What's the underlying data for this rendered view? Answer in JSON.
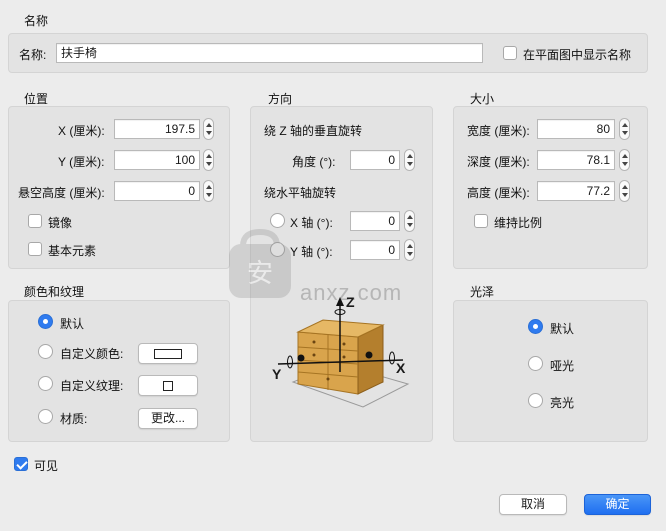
{
  "name_section": {
    "title": "名称",
    "name_label": "名称:",
    "name_value": "扶手椅",
    "show_in_plan_label": "在平面图中显示名称",
    "show_in_plan_checked": false
  },
  "position_section": {
    "title": "位置",
    "x_label": "X (厘米):",
    "x_value": "197.5",
    "y_label": "Y (厘米):",
    "y_value": "100",
    "elevation_label": "悬空高度 (厘米):",
    "elevation_value": "0",
    "mirror_label": "镜像",
    "mirror_checked": false,
    "basic_element_label": "基本元素",
    "basic_element_checked": false
  },
  "orientation_section": {
    "title": "方向",
    "z_rotate_label": "绕 Z 轴的垂直旋转",
    "angle_label": "角度 (°):",
    "angle_value": "0",
    "horizontal_rotate_label": "绕水平轴旋转",
    "x_axis_label": "X 轴 (°):",
    "x_axis_value": "0",
    "y_axis_label": "Y 轴 (°):",
    "y_axis_value": "0",
    "axis_labels": {
      "z": "Z",
      "x": "X",
      "y": "Y"
    }
  },
  "size_section": {
    "title": "大小",
    "width_label": "宽度 (厘米):",
    "width_value": "80",
    "depth_label": "深度 (厘米):",
    "depth_value": "78.1",
    "height_label": "高度 (厘米):",
    "height_value": "77.2",
    "keep_ratio_label": "维持比例",
    "keep_ratio_checked": false
  },
  "color_section": {
    "title": "颜色和纹理",
    "default_label": "默认",
    "custom_color_label": "自定义颜色:",
    "custom_texture_label": "自定义纹理:",
    "material_label": "材质:",
    "material_button_label": "更改...",
    "selected": "default"
  },
  "gloss_section": {
    "title": "光泽",
    "default_label": "默认",
    "matte_label": "哑光",
    "shiny_label": "亮光",
    "selected": "default"
  },
  "visible": {
    "label": "可见",
    "checked": true
  },
  "buttons": {
    "cancel": "取消",
    "ok": "确定"
  },
  "watermark": {
    "text": "anxz.com"
  },
  "colors": {
    "accent": "#2f7bef",
    "group_bg": "#e3e3e3",
    "window_bg": "#ececec"
  }
}
